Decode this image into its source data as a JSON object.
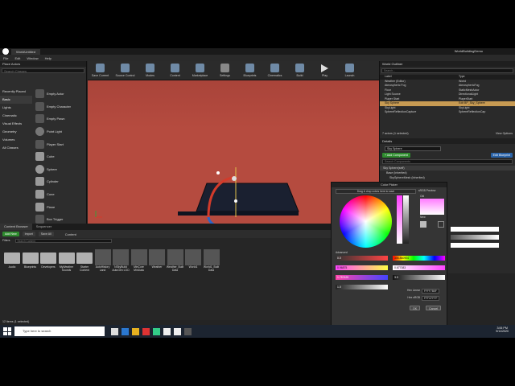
{
  "window": {
    "tab": "WorldUntitled",
    "brand": "WorldBuildingDemo"
  },
  "menu": [
    "File",
    "Edit",
    "Window",
    "Help"
  ],
  "place_actors": {
    "title": "Place Actors",
    "search_placeholder": "Search Classes",
    "categories": [
      "Recently Placed",
      "Basic",
      "Lights",
      "Cinematic",
      "Visual Effects",
      "Geometry",
      "Volumes",
      "All Classes"
    ],
    "selected_category": 1,
    "actors": [
      "Empty Actor",
      "Empty Character",
      "Empty Pawn",
      "Point Light",
      "Player Start",
      "Cube",
      "Sphere",
      "Cylinder",
      "Cone",
      "Plane",
      "Box Trigger",
      "Sphere Trigger"
    ]
  },
  "toolbar": [
    "Save Current",
    "Source Control",
    "Modes",
    "Content",
    "Marketplace",
    "Settings",
    "Blueprints",
    "Cinematics",
    "Build",
    "Play",
    "Launch"
  ],
  "viewport": {
    "buttons": [
      "Perspective",
      "Lit",
      "Show"
    ],
    "snap": [
      "10",
      "10°",
      "0.25"
    ]
  },
  "outliner": {
    "title": "World Outliner",
    "search_placeholder": "Search...",
    "col_label": "Label",
    "col_type": "Type",
    "rows": [
      {
        "label": "Weather (Editor)",
        "type": "World"
      },
      {
        "label": "Atmospheric Fog",
        "type": "AtmosphericFog"
      },
      {
        "label": "Floor",
        "type": "StaticMeshActor"
      },
      {
        "label": "Light Source",
        "type": "DirectionalLight"
      },
      {
        "label": "Player Start",
        "type": "PlayerStart"
      },
      {
        "label": "Sky Sphere",
        "type": "Edit BP_Sky_Sphere"
      },
      {
        "label": "SkyLight",
        "type": "SkyLight"
      },
      {
        "label": "SphereReflectionCapture",
        "type": "SphereReflectionCap"
      }
    ],
    "selected_row": 5,
    "status": "7 actors (1 selected)",
    "view_options": "View Options"
  },
  "details": {
    "title": "Details",
    "name_value": "Sky Sphere",
    "add_component": "+ Add Component",
    "edit_blueprint": "Edit Blueprint",
    "search_placeholder": "Search Components",
    "comp_root": "Sky Sphere(self)",
    "comp_base": "Base (Inherited)",
    "comp_child": "SkySphereMesh (Inherited)"
  },
  "content_browser": {
    "tab": "Content Browser",
    "tab2": "Sequencer",
    "add_new": "Add New",
    "import": "Import",
    "save_all": "Save All",
    "path": "Content",
    "filters": "Filters",
    "search_placeholder": "Search Content",
    "assets": [
      {
        "name": "Audio",
        "kind": "folder"
      },
      {
        "name": "Blueprints",
        "kind": "folder"
      },
      {
        "name": "Developers",
        "kind": "folder"
      },
      {
        "name": "MyWeather Sounds",
        "kind": "folder"
      },
      {
        "name": "Starter Content",
        "kind": "folder"
      },
      {
        "name": "AutoHistory Land",
        "kind": "asset"
      },
      {
        "name": "NSkyBuild AutoGen LOD",
        "kind": "asset"
      },
      {
        "name": "MinCore MinData",
        "kind": "asset"
      },
      {
        "name": "Weather",
        "kind": "asset"
      },
      {
        "name": "Weather_Built Data",
        "kind": "asset"
      },
      {
        "name": "World1",
        "kind": "asset"
      },
      {
        "name": "World1_Built Data",
        "kind": "asset"
      }
    ],
    "status": "12 items (1 selected)"
  },
  "color_picker": {
    "title": "Color Picker",
    "drag_hint": "Drag & drop colors here to save",
    "srgb_preview": "sRGB Preview",
    "old_label": "Old",
    "new_label": "New",
    "advanced": "Advanced",
    "values": [
      "0.0",
      "0.96875",
      "1.757425",
      "1.0"
    ],
    "hsv": [
      "306.860904",
      "0.677083",
      "3.0"
    ],
    "hex_linear_label": "Hex Linear",
    "hex_linear": "FFFF7B5F",
    "hex_srgb_label": "Hex sRGB",
    "hex_srgb": "FFFCFFFF",
    "ok": "OK",
    "cancel": "Cancel"
  },
  "taskbar": {
    "search_placeholder": "Type here to search",
    "time": "3:06 PM",
    "date": "9/11/2020"
  },
  "colors": {
    "viewport_sky": "#b54b3f",
    "selection": "#c79a52",
    "accent_green": "#2e8b2e",
    "blueprint_blue": "#2a63a8"
  }
}
